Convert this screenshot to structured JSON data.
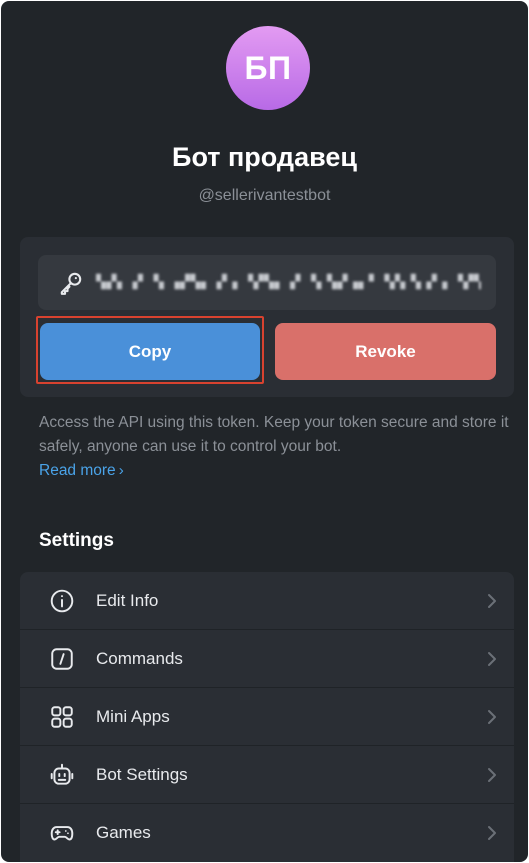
{
  "profile": {
    "avatar_initials": "БП",
    "name": "Бот продавец",
    "username": "@sellerivantestbot"
  },
  "token": {
    "masked_value": "▚▞▖▗▘▝▖▗▞▚▖▗▘▖▝▞▚▖▗▘▝▖▚▞▗▖▘▝▞▖▚▗▘▖▝▞▚▖▗▘▝▖▗▞▚▖▗▘▝▖▞▚▗"
  },
  "actions": {
    "copy_label": "Copy",
    "revoke_label": "Revoke"
  },
  "help": {
    "text": "Access the API using this token. Keep your token secure and store it safely, anyone can use it to control your bot.",
    "read_more": "Read more"
  },
  "settings": {
    "heading": "Settings",
    "items": [
      {
        "label": "Edit Info",
        "icon": "info-icon"
      },
      {
        "label": "Commands",
        "icon": "commands-icon"
      },
      {
        "label": "Mini Apps",
        "icon": "grid-icon"
      },
      {
        "label": "Bot Settings",
        "icon": "robot-icon"
      },
      {
        "label": "Games",
        "icon": "gamepad-icon"
      }
    ]
  },
  "colors": {
    "background": "#212529",
    "card": "#2a2e34",
    "copy_button": "#4a90d9",
    "revoke_button": "#d9706a",
    "link": "#4aa3e8",
    "highlight_border": "#d8422f"
  }
}
